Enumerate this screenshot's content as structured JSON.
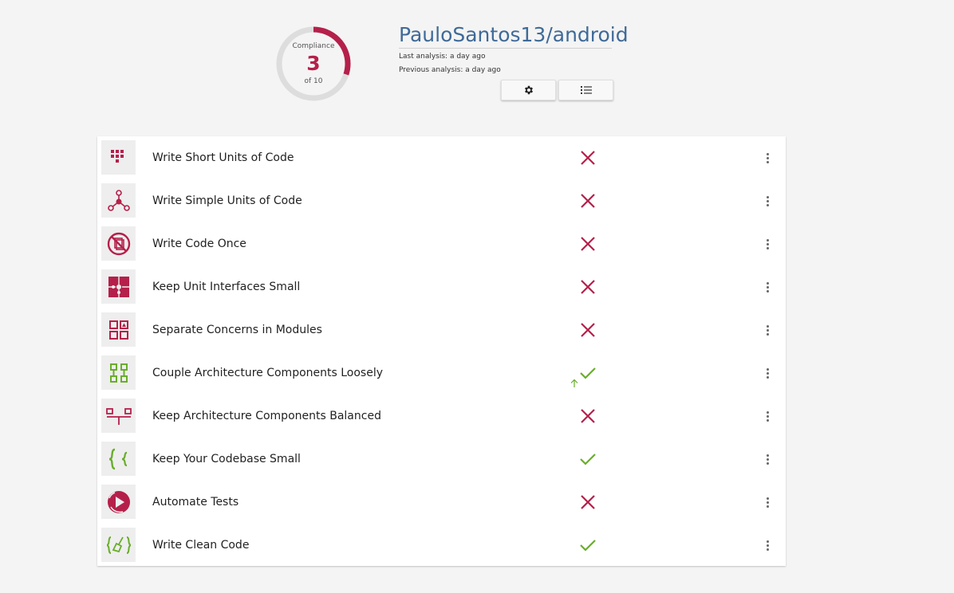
{
  "header": {
    "compliance_label": "Compliance",
    "score": "3",
    "score_total": "of 10",
    "repo_title": "PauloSantos13/android",
    "last_analysis": "Last analysis: a day ago",
    "previous_analysis": "Previous analysis: a day ago",
    "buttons": {
      "settings_icon": "gear-icon",
      "list_icon": "list-icon"
    }
  },
  "progress": {
    "compliant": 3,
    "total": 10
  },
  "colors": {
    "fail": "#b5204a",
    "pass": "#6aad2c",
    "title": "#3f6a98"
  },
  "guidelines": [
    {
      "name": "Write Short Units of Code",
      "icon": "short-units-icon",
      "status": "fail"
    },
    {
      "name": "Write Simple Units of Code",
      "icon": "simple-units-icon",
      "status": "fail"
    },
    {
      "name": "Write Code Once",
      "icon": "no-duplication-icon",
      "status": "fail"
    },
    {
      "name": "Keep Unit Interfaces Small",
      "icon": "puzzle-icon",
      "status": "fail"
    },
    {
      "name": "Separate Concerns in Modules",
      "icon": "modules-icon",
      "status": "fail"
    },
    {
      "name": "Couple Architecture Components Loosely",
      "icon": "components-icon",
      "status": "pass",
      "trend": "up"
    },
    {
      "name": "Keep Architecture Components Balanced",
      "icon": "balance-icon",
      "status": "fail"
    },
    {
      "name": "Keep Your Codebase Small",
      "icon": "braces-icon",
      "status": "pass"
    },
    {
      "name": "Automate Tests",
      "icon": "play-tests-icon",
      "status": "fail"
    },
    {
      "name": "Write Clean Code",
      "icon": "broom-icon",
      "status": "pass"
    }
  ]
}
